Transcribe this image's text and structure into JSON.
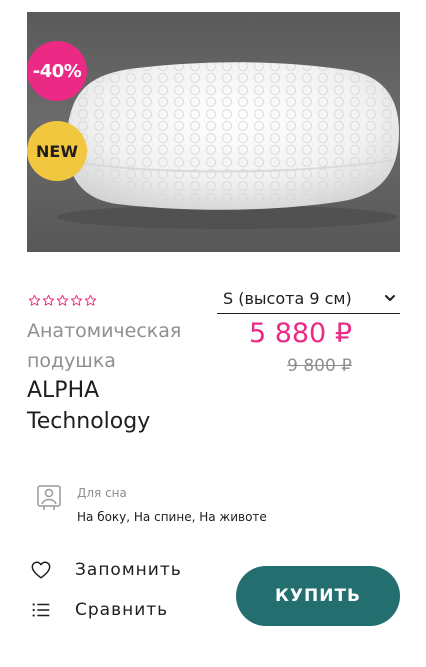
{
  "product": {
    "badges": {
      "discount": "-40%",
      "new": "NEW"
    },
    "rating": {
      "value": 0,
      "max": 5,
      "color": "#ea2a84"
    },
    "name_light": "Анатомическая подушка",
    "name_bold": "ALPHA Technology",
    "size_selected": "S (высота 9 см)",
    "price_current": "5 880 ₽",
    "price_old": "9 800 ₽",
    "feature": {
      "icon": "sleeper-icon",
      "title": "Для сна",
      "values": "На боку, На спине, На животе"
    }
  },
  "actions": {
    "favorite_label": "Запомнить",
    "compare_label": "Сравнить",
    "buy_label": "КУПИТЬ"
  },
  "colors": {
    "accent": "#ea2a84",
    "badge_new": "#f2c740",
    "buy_button": "#236e6e"
  }
}
